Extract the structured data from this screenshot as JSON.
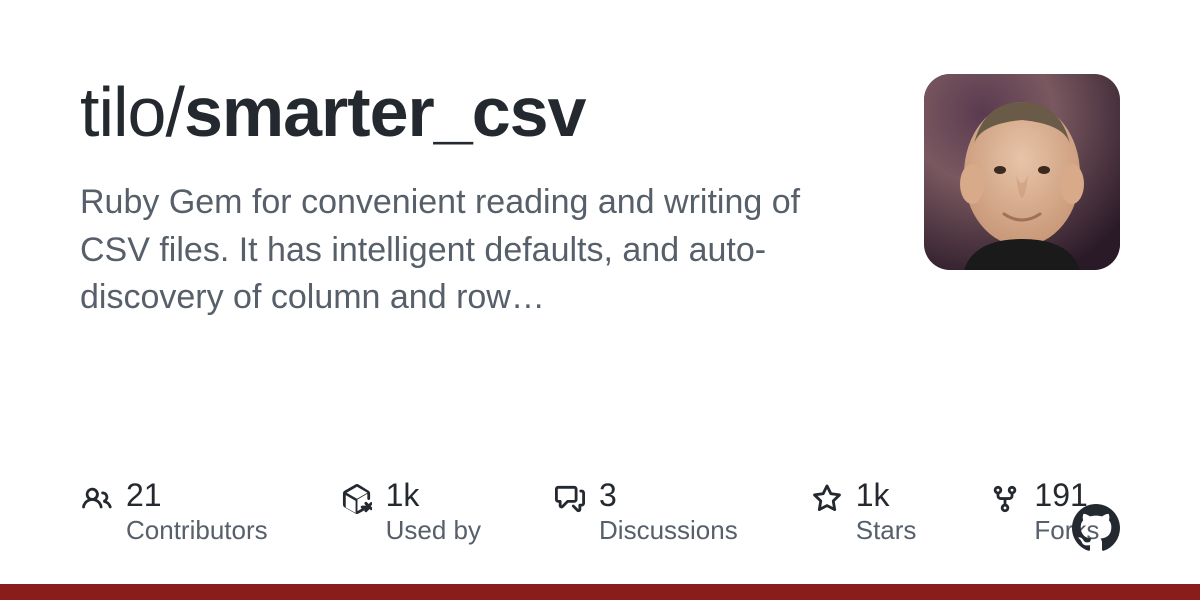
{
  "repo": {
    "owner": "tilo",
    "sep": "/",
    "name": "smarter_csv",
    "description": "Ruby Gem for convenient reading and writing of CSV files. It has intelligent defaults, and auto-discovery of column and row…"
  },
  "stats": {
    "contributors": {
      "value": "21",
      "label": "Contributors"
    },
    "used_by": {
      "value": "1k",
      "label": "Used by"
    },
    "discussions": {
      "value": "3",
      "label": "Discussions"
    },
    "stars": {
      "value": "1k",
      "label": "Stars"
    },
    "forks": {
      "value": "191",
      "label": "Forks"
    }
  },
  "accent_color": "#8a1c1c"
}
